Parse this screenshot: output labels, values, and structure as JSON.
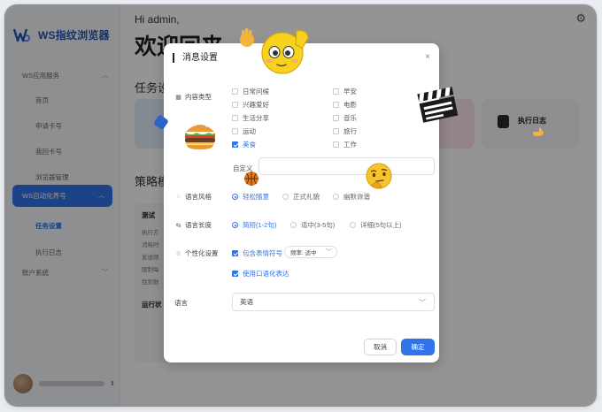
{
  "app": {
    "title": "WS指纹浏览器",
    "brand_color": "#2155b8",
    "accent_color": "#3173e8"
  },
  "sidebar": {
    "sections": [
      {
        "label": "WS应用服务",
        "items": [
          "首页",
          "申请卡号",
          "我回卡号",
          "浏览器管理"
        ]
      },
      {
        "label": "WS自动化养号",
        "items": [
          "任务设置",
          "执行日志"
        ],
        "active_item": "任务设置"
      },
      {
        "label": "账户系统",
        "items": []
      }
    ],
    "user_caret": "⇕"
  },
  "main": {
    "greeting": "Hi admin,",
    "welcome": "欢迎回来",
    "section_tasks": "任务设",
    "section_strategy": "策略模",
    "card_log_label": "执行日志",
    "panel_title": "测试",
    "panel_lines": [
      "执行方",
      "消耗时",
      "发送频",
      "限制每",
      "找到数"
    ],
    "panel2_title": "运行状"
  },
  "dialog": {
    "title": "消息设置",
    "close": "×",
    "message_type": {
      "label": "内容类型",
      "options": [
        {
          "label": "日常问候",
          "checked": false
        },
        {
          "label": "早安",
          "checked": false
        },
        {
          "label": "兴趣爱好",
          "checked": false
        },
        {
          "label": "电影",
          "checked": false
        },
        {
          "label": "生活分享",
          "checked": false
        },
        {
          "label": "音乐",
          "checked": false
        },
        {
          "label": "运动",
          "checked": false
        },
        {
          "label": "旅行",
          "checked": false
        },
        {
          "label": "美食",
          "checked": true
        },
        {
          "label": "工作",
          "checked": false
        }
      ],
      "custom_label": "自定义",
      "custom_placeholder": ""
    },
    "style": {
      "label": "语言风格",
      "options": [
        {
          "label": "轻松随意",
          "checked": true
        },
        {
          "label": "正式礼貌",
          "checked": false
        },
        {
          "label": "幽默诙谐",
          "checked": false
        }
      ]
    },
    "length": {
      "label": "语言长度",
      "options": [
        {
          "label": "简短(1-2句)",
          "checked": true
        },
        {
          "label": "适中(3-5句)",
          "checked": false
        },
        {
          "label": "详细(5句以上)",
          "checked": false
        }
      ]
    },
    "personalize": {
      "label": "个性化设置",
      "emoji_label": "包含表情符号",
      "emoji_checked": true,
      "freq_value": "频率: 适中",
      "colloquial_label": "使用口语化表达",
      "colloquial_checked": true
    },
    "language": {
      "label": "语言",
      "value": "英语"
    },
    "cancel": "取消",
    "confirm": "确定"
  }
}
